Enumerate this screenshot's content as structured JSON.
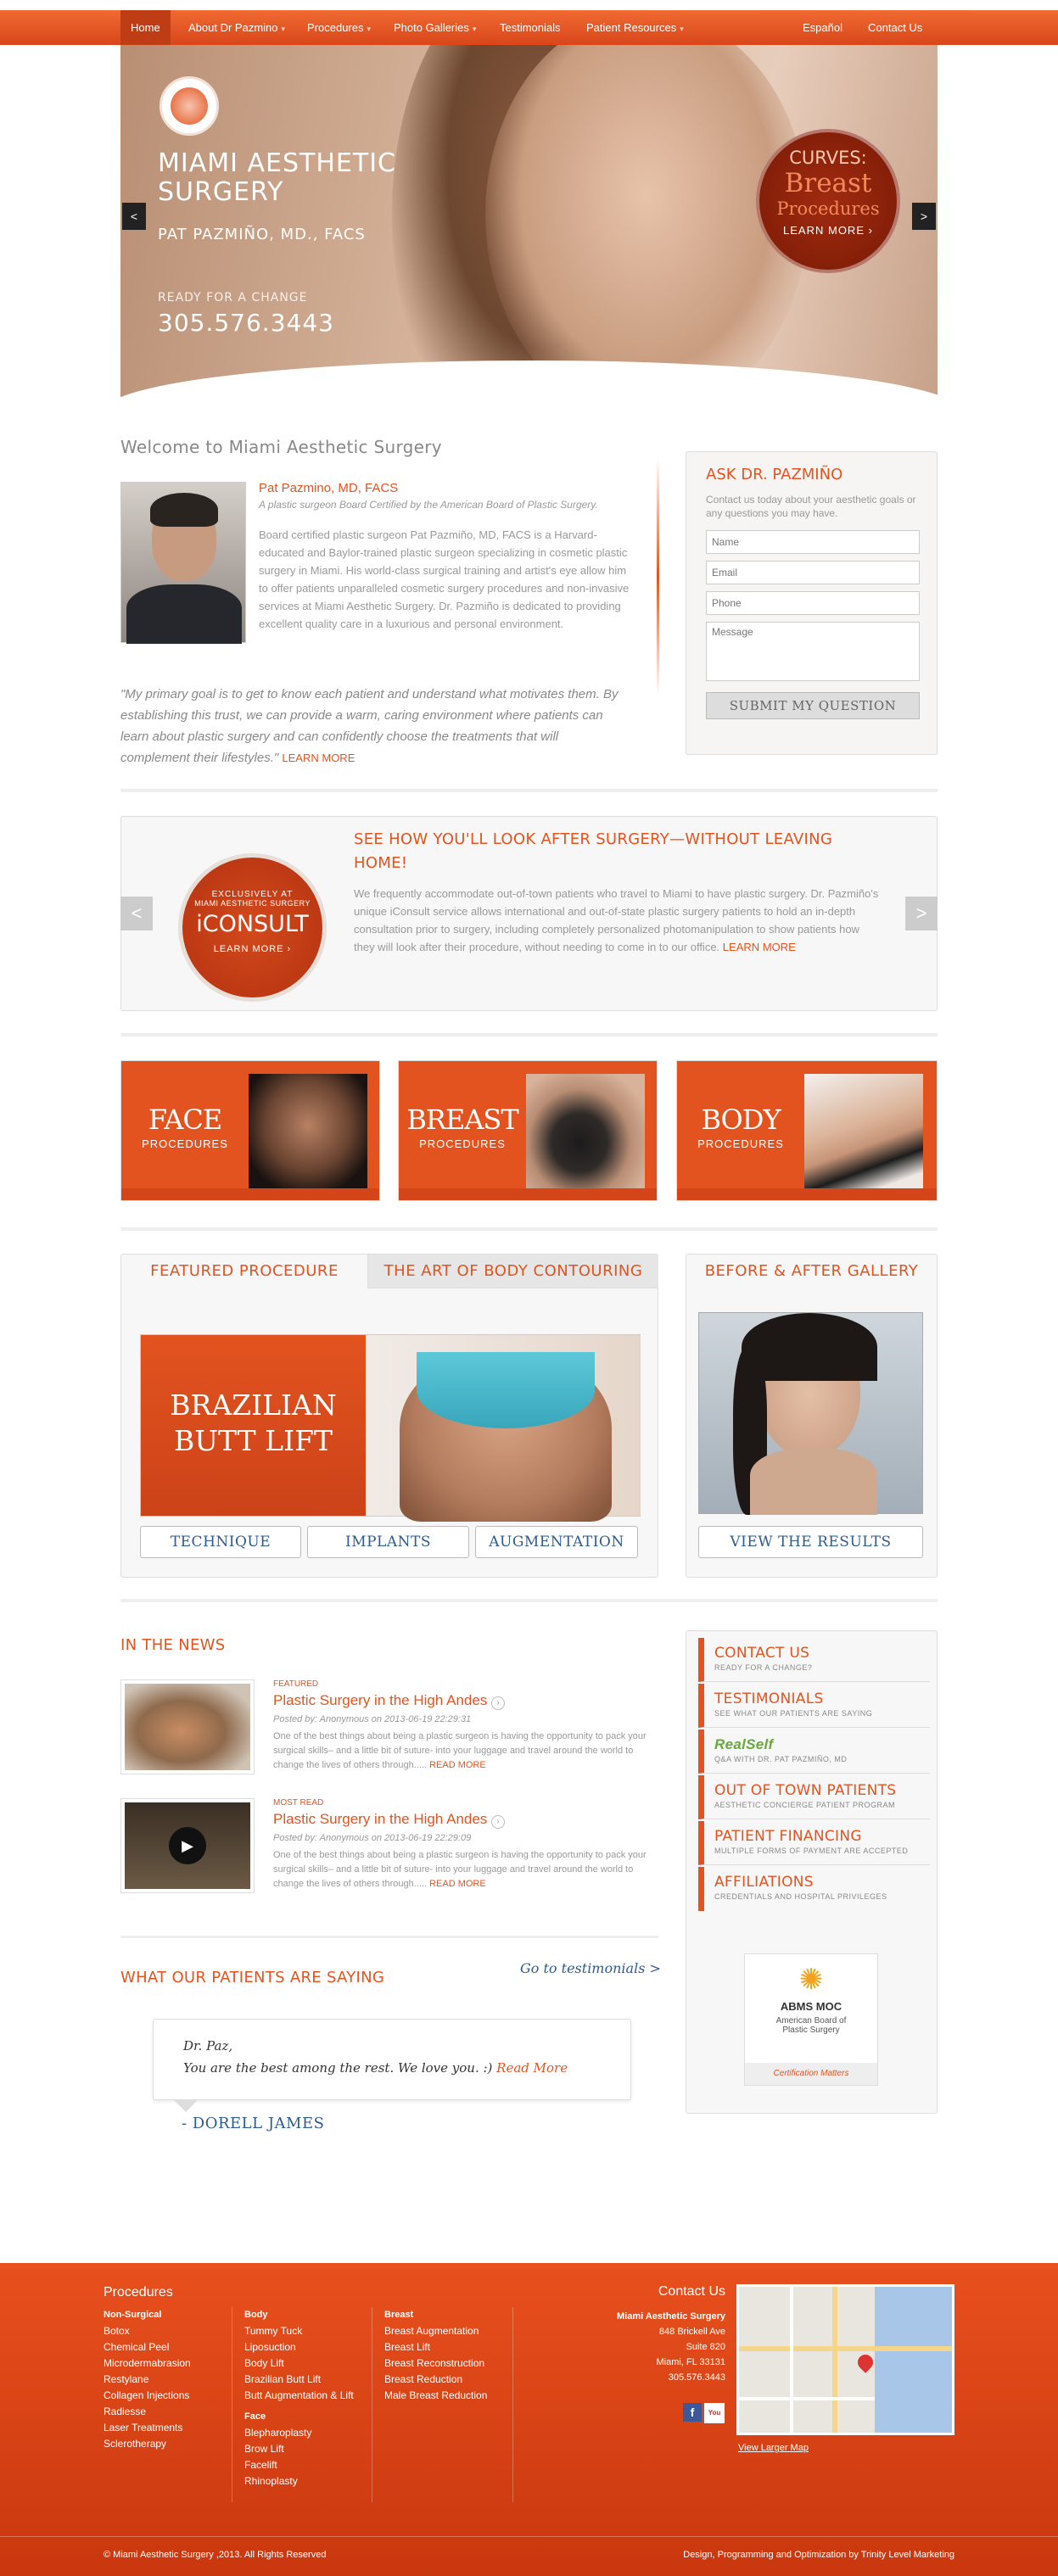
{
  "nav": {
    "items": [
      "Home",
      "About Dr Pazmino",
      "Procedures",
      "Photo Galleries",
      "Testimonials",
      "Patient Resources"
    ],
    "right": [
      "Español",
      "Contact Us"
    ]
  },
  "hero": {
    "title_line1": "MIAMI AESTHETIC",
    "title_line2": "SURGERY",
    "doctor": "PAT PAZMIÑO, MD., FACS",
    "cta": "READY FOR A CHANGE",
    "phone": "305.576.3443",
    "badge_top": "CURVES:",
    "badge_mid": "Breast",
    "badge_low": "Procedures",
    "badge_link": "LEARN MORE",
    "prev": "<",
    "next": ">"
  },
  "welcome": {
    "title": "Welcome to Miami Aesthetic Surgery",
    "name": "Pat Pazmino, MD, FACS",
    "cert": "A plastic surgeon Board Certified by the American Board of Plastic Surgery.",
    "bio": "Board certified plastic surgeon Pat Pazmiño, MD, FACS is a Harvard-educated and Baylor-trained plastic surgeon specializing in cosmetic plastic surgery in Miami. His world-class surgical training and artist's eye allow him to offer patients unparalleled cosmetic surgery procedures and non-invasive services at Miami Aesthetic Surgery. Dr. Pazmiño is dedicated to providing excellent quality care in a luxurious and personal environment.",
    "quote": "\"My primary goal is to get to know each patient and understand what motivates them. By establishing this trust, we can provide a warm, caring environment where patients can learn about plastic surgery and can confidently choose the treatments that will complement their lifestyles.\"",
    "learn_more": "LEARN MORE"
  },
  "ask": {
    "title": "ASK DR. PAZMIÑO",
    "intro": "Contact us today about your aesthetic goals or any questions you may have.",
    "name_ph": "Name",
    "email_ph": "Email",
    "phone_ph": "Phone",
    "message_ph": "Message",
    "submit": "SUBMIT MY QUESTION"
  },
  "iconsult": {
    "circle_top": "EXCLUSIVELY AT",
    "circle_sub": "MIAMI AESTHETIC SURGERY",
    "circle_brand": "iCONSULT",
    "circle_link": "LEARN MORE",
    "title": "SEE HOW YOU'LL LOOK AFTER SURGERY—WITHOUT LEAVING HOME!",
    "text": "We frequently accommodate out-of-town patients who travel to Miami to have plastic surgery. Dr. Pazmiño's unique iConsult service allows international and out-of-state plastic surgery patients to hold an in-depth consultation prior to surgery, including completely personalized photomanipulation to show patients how they will look after their procedure, without needing to come in to our office.",
    "learn_more": "LEARN MORE",
    "prev": "<",
    "next": ">"
  },
  "tiles": [
    {
      "label": "FACE",
      "sub": "PROCEDURES"
    },
    {
      "label": "BREAST",
      "sub": "PROCEDURES"
    },
    {
      "label": "BODY",
      "sub": "PROCEDURES"
    }
  ],
  "featured": {
    "tab1": "FEATURED PROCEDURE",
    "tab2": "THE ART OF BODY CONTOURING",
    "banner_l1": "BRAZILIAN",
    "banner_l2": "BUTT LIFT",
    "buttons": [
      "TECHNIQUE",
      "IMPLANTS",
      "AUGMENTATION"
    ]
  },
  "before": {
    "title": "BEFORE & AFTER GALLERY",
    "button": "VIEW THE RESULTS"
  },
  "news": {
    "title": "IN THE NEWS",
    "items": [
      {
        "tag": "FEATURED",
        "title": "Plastic Surgery in the High Andes",
        "meta": "Posted by: Anonymous on 2013-06-19 22:29:31",
        "excerpt": "One of the best things about being a plastic surgeon is having the opportunity to pack your surgical skills– and a little bit of suture- into your luggage and travel around the world to change the lives of others through.....",
        "more": "READ MORE"
      },
      {
        "tag": "MOST READ",
        "title": "Plastic Surgery in the High Andes",
        "meta": "Posted by: Anonymous on 2013-06-19 22:29:09",
        "excerpt": "One of the best things about being a plastic surgeon is having the opportunity to pack your surgical skills– and a little bit of suture- into your luggage and travel around the world to change the lives of others through.....",
        "more": "READ MORE"
      }
    ]
  },
  "links": [
    {
      "title": "CONTACT US",
      "sub": "READY FOR A CHANGE?"
    },
    {
      "title": "TESTIMONIALS",
      "sub": "SEE WHAT OUR PATIENTS ARE SAYING"
    },
    {
      "title": "RealSelf",
      "sub": "Q&A WITH DR. PAT PAZMIÑO, MD"
    },
    {
      "title": "OUT OF TOWN PATIENTS",
      "sub": "AESTHETIC CONCIERGE PATIENT PROGRAM"
    },
    {
      "title": "PATIENT FINANCING",
      "sub": "MULTIPLE FORMS OF PAYMENT ARE ACCEPTED"
    },
    {
      "title": "AFFILIATIONS",
      "sub": "CREDENTIALS AND HOSPITAL PRIVILEGES"
    }
  ],
  "abms": {
    "name": "ABMS MOC",
    "line1": "American Board of",
    "line2": "Plastic Surgery",
    "foot": "Certification Matters"
  },
  "testimonials": {
    "title": "WHAT OUR PATIENTS ARE SAYING",
    "goto": "Go to testimonials >",
    "salutation": "Dr. Paz,",
    "text": "You are the best among the rest. We love you. :)",
    "read_more": "Read More",
    "author": "- DORELL JAMES"
  },
  "footer": {
    "procedures_title": "Procedures",
    "col1_head": "Non-Surgical",
    "col1": [
      "Botox",
      "Chemical Peel",
      "Microdermabrasion",
      "Restylane",
      "Collagen Injections",
      "Radiesse",
      "Laser Treatments",
      "Sclerotherapy"
    ],
    "col2_head": "Body",
    "col2": [
      "Tummy Tuck",
      "Liposuction",
      "Body Lift",
      "Brazilian Butt Lift",
      "Butt Augmentation & Lift"
    ],
    "col2b_head": "Face",
    "col2b": [
      "Blepharoplasty",
      "Brow Lift",
      "Facelift",
      "Rhinoplasty"
    ],
    "col3_head": "Breast",
    "col3": [
      "Breast Augmentation",
      "Breast Lift",
      "Breast Reconstruction",
      "Breast Reduction",
      "Male Breast Reduction"
    ],
    "contact_title": "Contact Us",
    "contact_name": "Miami Aesthetic Surgery",
    "contact_lines": [
      "848 Brickell Ave",
      "Suite 820",
      "Miami, FL 33131",
      "305.576.3443"
    ],
    "map_link": "View Larger Map",
    "copyright": "© Miami Aesthetic Surgery ,2013. All Rights Reserved",
    "credit": "Design, Programming and Optimization by Trinity Level Marketing"
  }
}
